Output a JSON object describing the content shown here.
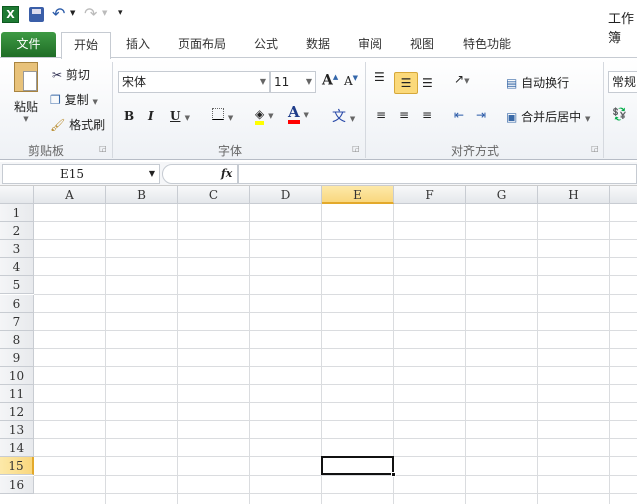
{
  "window": {
    "title": "工作簿"
  },
  "tabs": [
    "文件",
    "开始",
    "插入",
    "页面布局",
    "公式",
    "数据",
    "审阅",
    "视图",
    "特色功能"
  ],
  "clipboard": {
    "paste": "粘贴",
    "cut": "剪切",
    "copy": "复制",
    "format_painter": "格式刷",
    "label": "剪贴板"
  },
  "font": {
    "name": "宋体",
    "size": "11",
    "label": "字体",
    "bold": "B",
    "italic": "I",
    "underline": "U",
    "phonetic": "文"
  },
  "alignment": {
    "wrap": "自动换行",
    "merge": "合并后居中",
    "label": "对齐方式"
  },
  "number": {
    "format": "常规"
  },
  "formula_bar": {
    "name_box": "E15",
    "fx": "fx",
    "value": ""
  },
  "columns": [
    "A",
    "B",
    "C",
    "D",
    "E",
    "F",
    "G",
    "H"
  ],
  "rows": [
    "1",
    "2",
    "3",
    "4",
    "5",
    "6",
    "7",
    "8",
    "9",
    "10",
    "11",
    "12",
    "13",
    "14",
    "15",
    "16"
  ],
  "selected": {
    "col": "E",
    "row": "15"
  },
  "colors": {
    "file_tab": "#2e7d32",
    "highlight": "#ffff00",
    "font_color": "#ff0000",
    "active_header": "#f9d77e"
  }
}
